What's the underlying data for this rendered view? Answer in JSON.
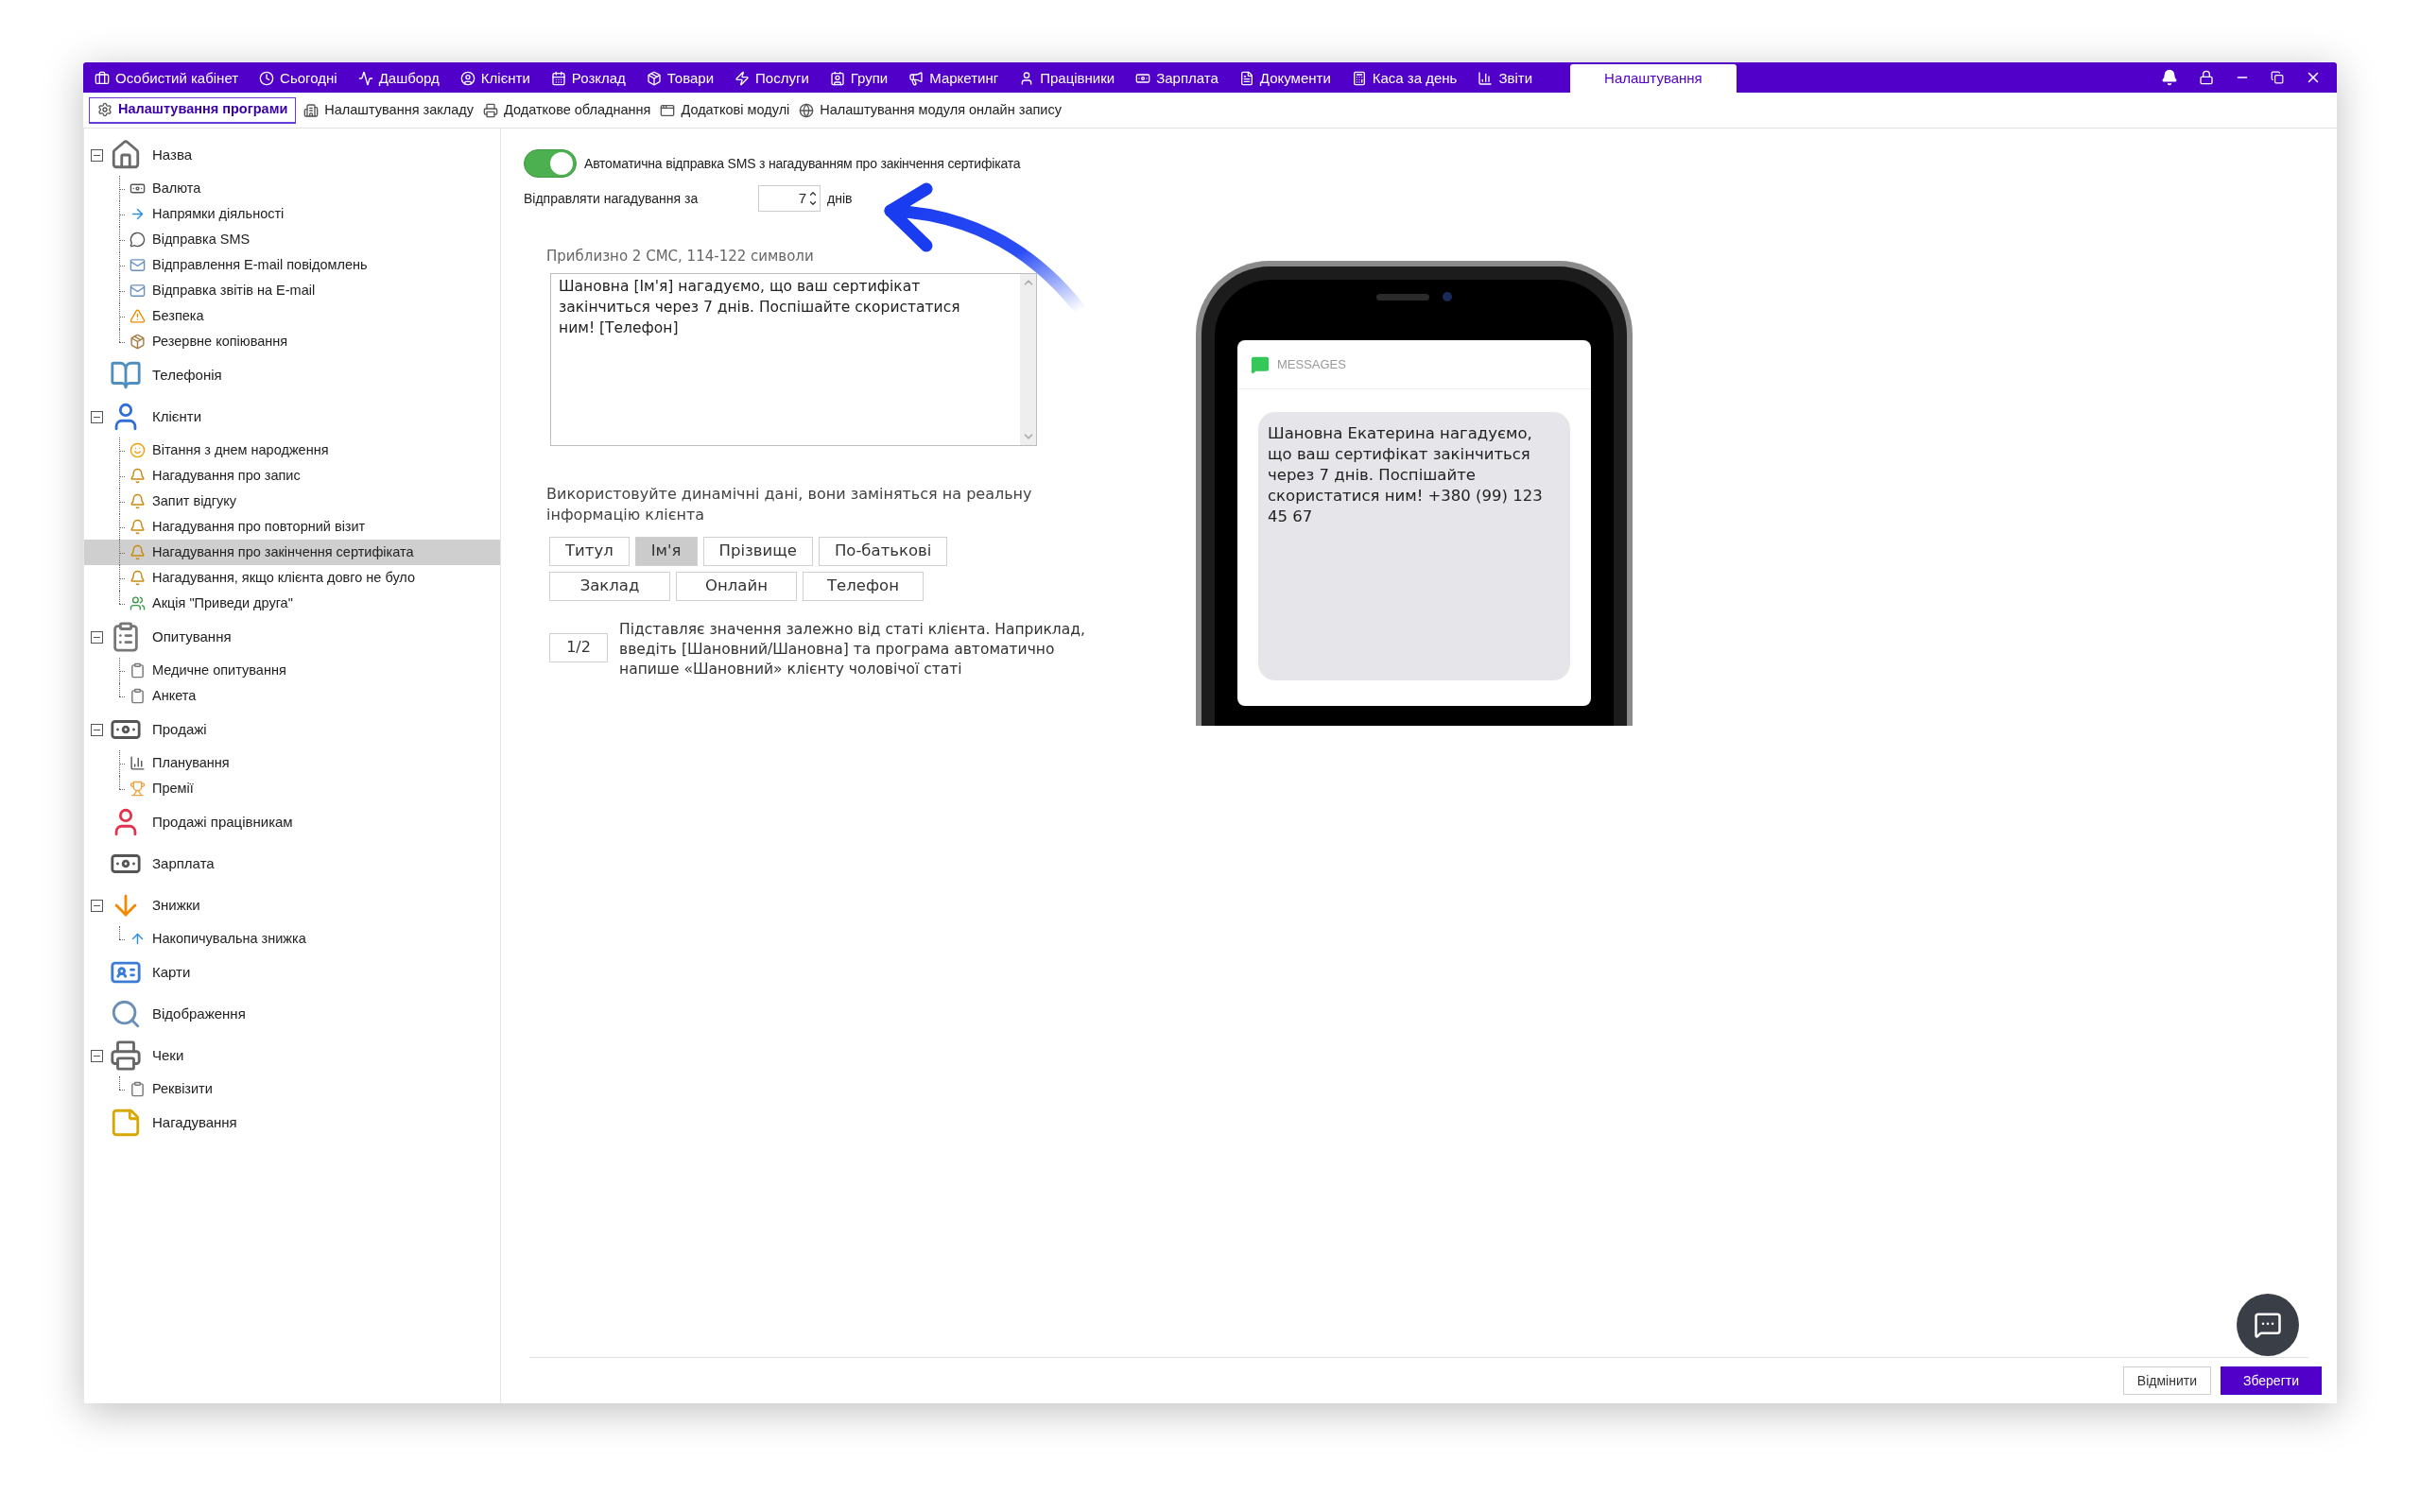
{
  "top_menu": [
    {
      "label": "Особистий кабінет",
      "selected": false
    },
    {
      "label": "Сьогодні",
      "selected": false
    },
    {
      "label": "Дашборд",
      "selected": false
    },
    {
      "label": "Клієнти",
      "selected": false
    },
    {
      "label": "Розклад",
      "selected": false
    },
    {
      "label": "Товари",
      "selected": false
    },
    {
      "label": "Послуги",
      "selected": false
    },
    {
      "label": "Групи",
      "selected": false
    },
    {
      "label": "Маркетинг",
      "selected": false
    },
    {
      "label": "Працівники",
      "selected": false
    },
    {
      "label": "Зарплата",
      "selected": false
    },
    {
      "label": "Документи",
      "selected": false
    },
    {
      "label": "Каса за день",
      "selected": false
    },
    {
      "label": "Звіти",
      "selected": false
    },
    {
      "label": "Налаштування",
      "selected": true
    }
  ],
  "settings_tabs": [
    {
      "label": "Налаштування програми",
      "selected": true
    },
    {
      "label": "Налаштування закладу",
      "selected": false
    },
    {
      "label": "Додаткове обладнання",
      "selected": false
    },
    {
      "label": "Додаткові модулі",
      "selected": false
    },
    {
      "label": "Налаштування модуля онлайн запису",
      "selected": false
    }
  ],
  "tree": [
    {
      "label": "Назва",
      "selected": false,
      "expanded": true,
      "children": [
        {
          "label": "Валюта",
          "selected": false
        },
        {
          "label": "Напрямки діяльності",
          "selected": false
        },
        {
          "label": "Відправка SMS",
          "selected": false
        },
        {
          "label": "Відправлення E-mail повідомлень",
          "selected": false
        },
        {
          "label": "Відправка звітів на E-mail",
          "selected": false
        },
        {
          "label": "Безпека",
          "selected": false
        },
        {
          "label": "Резервне копіювання",
          "selected": false
        }
      ]
    },
    {
      "label": "Телефонія",
      "selected": false
    },
    {
      "label": "Клієнти",
      "selected": false,
      "expanded": true,
      "children": [
        {
          "label": "Вітання з днем народження",
          "selected": false
        },
        {
          "label": "Нагадування про запис",
          "selected": false
        },
        {
          "label": "Запит відгуку",
          "selected": false
        },
        {
          "label": "Нагадування про повторний візит",
          "selected": false
        },
        {
          "label": "Нагадування про закінчення сертифіката",
          "selected": true
        },
        {
          "label": "Нагадування, якщо клієнта довго не було",
          "selected": false
        },
        {
          "label": "Акція \"Приведи друга\"",
          "selected": false
        }
      ]
    },
    {
      "label": "Опитування",
      "selected": false,
      "expanded": true,
      "children": [
        {
          "label": "Медичне опитування",
          "selected": false
        },
        {
          "label": "Анкета",
          "selected": false
        }
      ]
    },
    {
      "label": "Продажі",
      "selected": false,
      "expanded": true,
      "children": [
        {
          "label": "Планування",
          "selected": false
        },
        {
          "label": "Премії",
          "selected": false
        }
      ]
    },
    {
      "label": "Продажі працівникам",
      "selected": false
    },
    {
      "label": "Зарплата",
      "selected": false
    },
    {
      "label": "Знижки",
      "selected": false,
      "expanded": true,
      "children": [
        {
          "label": "Накопичувальна знижка",
          "selected": false
        }
      ]
    },
    {
      "label": "Карти",
      "selected": false
    },
    {
      "label": "Відображення",
      "selected": false
    },
    {
      "label": "Чеки",
      "selected": false,
      "expanded": true,
      "children": [
        {
          "label": "Реквізити",
          "selected": false
        }
      ]
    },
    {
      "label": "Нагадування",
      "selected": false
    }
  ],
  "sms_settings": {
    "auto_send": {
      "label": "Автоматична відправка SMS з нагадуванням про закінчення сертифіката",
      "on": true
    },
    "send_before": {
      "label": "Відправляти нагадування за",
      "value": "7",
      "unit": "днів"
    },
    "estimate": "Приблизно 2 СМС, 114-122 символи",
    "template": "Шановна [Ім'я] нагадуємо, що ваш сертифікат закінчиться через 7 днів. Поспішайте скористатися ним! [Телефон]",
    "dynamic_hint": "Використовуйте динамічні дані, вони заміняться на реальну інформацію клієнта",
    "variables": [
      {
        "label": "Титул",
        "selected": false
      },
      {
        "label": "Ім'я",
        "selected": true
      },
      {
        "label": "Прізвище",
        "selected": false
      },
      {
        "label": "По-батькові",
        "selected": false
      },
      {
        "label": "Заклад",
        "selected": false
      },
      {
        "label": "Онлайн",
        "selected": false
      },
      {
        "label": "Телефон",
        "selected": false
      }
    ],
    "gender_variable": {
      "label": "1/2",
      "description": "Підставляє значення залежно від статі клієнта. Наприклад, введіть [Шановний/Шановна] та програма автоматично напише «Шановний» клієнту чоловічої статі"
    }
  },
  "preview": {
    "app": "MESSAGES",
    "message": "Шановна Екатерина нагадуємо, що ваш сертифікат закінчиться через 7 днів. Поспішайте скористатися ним! +380 (99) 123 45 67"
  },
  "buttons": [
    {
      "label": "Відмінити",
      "kind": "secondary"
    },
    {
      "label": "Зберегти",
      "kind": "primary"
    }
  ]
}
